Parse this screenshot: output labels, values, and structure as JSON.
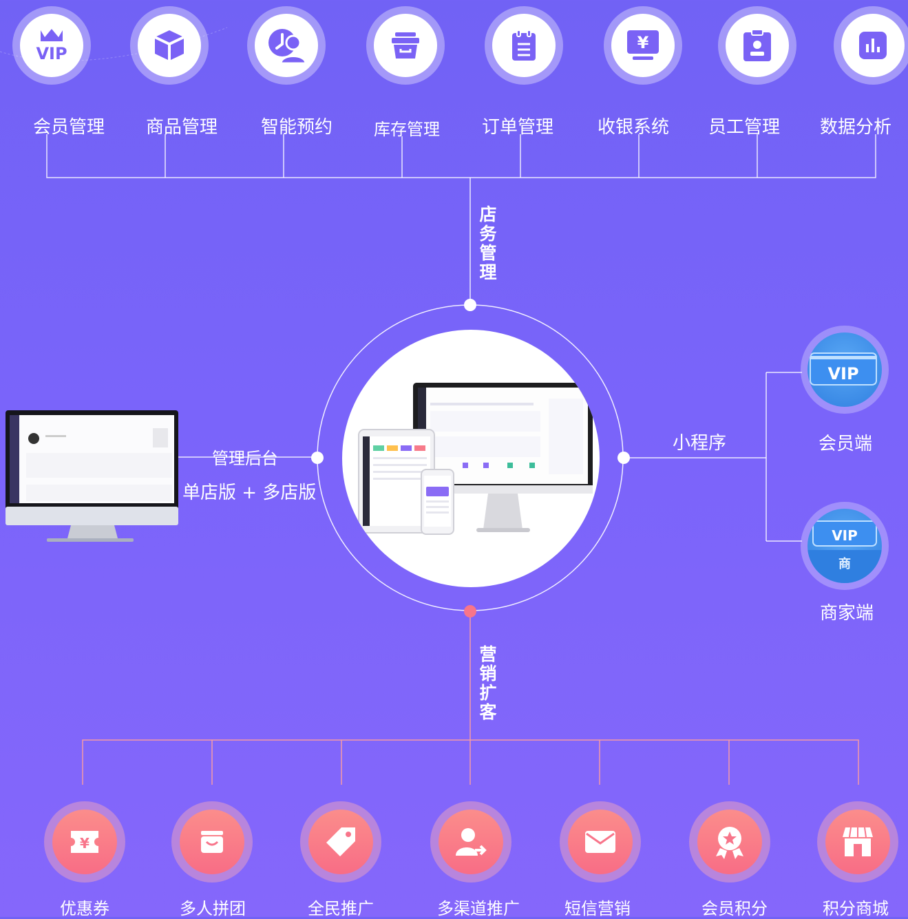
{
  "store_management": {
    "title": "店务管理",
    "items": [
      {
        "label": "会员管理",
        "icon": "vip-crown-icon"
      },
      {
        "label": "商品管理",
        "icon": "box-icon"
      },
      {
        "label": "智能预约",
        "icon": "appointment-clock-person-icon"
      },
      {
        "label": "库存管理",
        "icon": "inventory-basket-icon"
      },
      {
        "label": "订单管理",
        "icon": "order-clipboard-icon"
      },
      {
        "label": "收银系统",
        "icon": "cashier-monitor-yen-icon"
      },
      {
        "label": "员工管理",
        "icon": "employee-badge-icon"
      },
      {
        "label": "数据分析",
        "icon": "bar-chart-icon"
      }
    ]
  },
  "marketing": {
    "title": "营销扩客",
    "items": [
      {
        "label": "优惠券",
        "icon": "coupon-yen-icon"
      },
      {
        "label": "多人拼团",
        "icon": "shopping-bag-icon"
      },
      {
        "label": "全民推广",
        "icon": "price-tag-icon"
      },
      {
        "label": "多渠道推广",
        "icon": "user-share-icon"
      },
      {
        "label": "短信营销",
        "icon": "envelope-icon"
      },
      {
        "label": "会员积分",
        "icon": "award-medal-icon"
      },
      {
        "label": "积分商城",
        "icon": "storefront-icon"
      }
    ]
  },
  "left": {
    "label": "管理后台",
    "sub_label": "单店版 + 多店版"
  },
  "right": {
    "label": "小程序",
    "clients": [
      {
        "label": "会员端",
        "badge": "VIP"
      },
      {
        "label": "商家端",
        "badge": "VIP",
        "badge_sub": "商"
      }
    ]
  },
  "colors": {
    "background": "#7766f8",
    "accent_marketing": "#f8758a",
    "line_marketing": "#f59aa6",
    "icon_purple": "#7a62f5",
    "vip_blue": "#2f7fe0"
  }
}
